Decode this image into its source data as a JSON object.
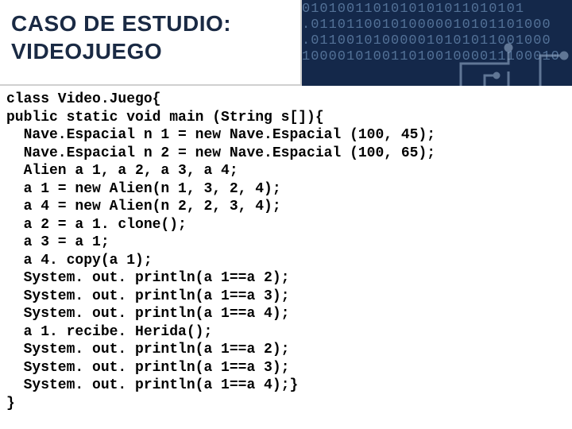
{
  "header": {
    "title_line1": "CASO DE ESTUDIO:",
    "title_line2": "VIDEOJUEGO",
    "binary_lines": [
      "0101001101010101011010101",
      ".011011001010000010101101000",
      ".011001010000010101011001000",
      "10000101001101001000011100010"
    ]
  },
  "code": {
    "lines": [
      "class Video.Juego{",
      "public static void main (String s[]){",
      "  Nave.Espacial n 1 = new Nave.Espacial (100, 45);",
      "  Nave.Espacial n 2 = new Nave.Espacial (100, 65);",
      "  Alien a 1, a 2, a 3, a 4;",
      "  a 1 = new Alien(n 1, 3, 2, 4);",
      "  a 4 = new Alien(n 2, 2, 3, 4);",
      "  a 2 = a 1. clone();",
      "  a 3 = a 1;",
      "  a 4. copy(a 1);",
      "  System. out. println(a 1==a 2);",
      "  System. out. println(a 1==a 3);",
      "  System. out. println(a 1==a 4);",
      "  a 1. recibe. Herida();",
      "  System. out. println(a 1==a 2);",
      "  System. out. println(a 1==a 3);",
      "  System. out. println(a 1==a 4);}",
      "}"
    ]
  }
}
